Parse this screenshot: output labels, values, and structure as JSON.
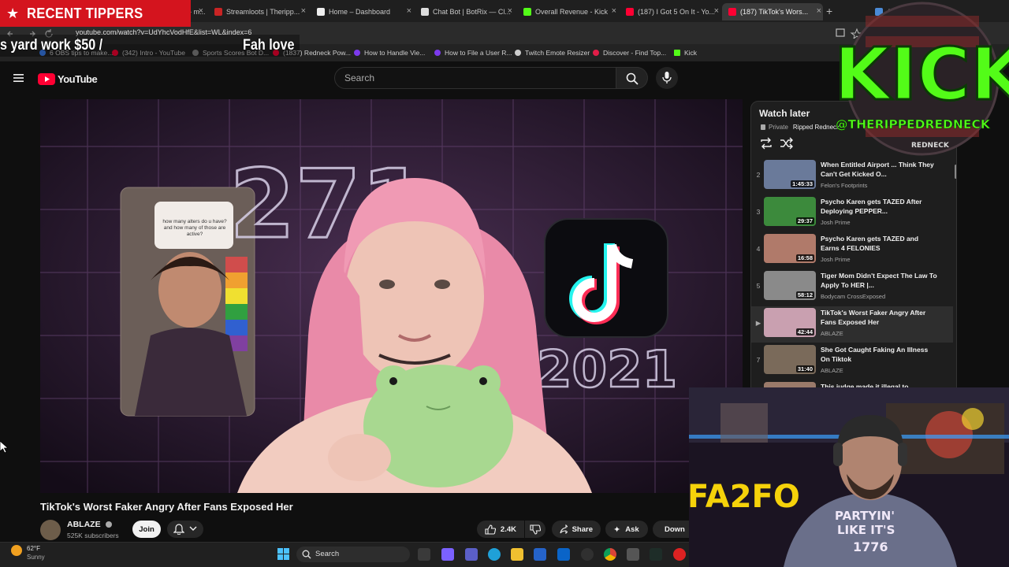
{
  "overlay": {
    "tipper_title": "RECENT TIPPERS",
    "ticker_left": "s yard work $50 /",
    "ticker_right": "Fah love",
    "kick_logo_text": "KICK",
    "kick_handle": "@THERIPPEDREDNECK",
    "kick_logo_sub": "REDNECK",
    "shirt_text_1": "PARTYIN'",
    "shirt_text_2": "LIKE IT'S",
    "shirt_text_3": "1776",
    "webcam_sign": "FA2FO"
  },
  "browser": {
    "tabs": [
      {
        "label": "...eamElements - m...",
        "color": "#4a6fd6",
        "active": false
      },
      {
        "label": "Streamloots | Theripp...",
        "color": "#c92424",
        "active": false
      },
      {
        "label": "Home – Dashboard",
        "color": "#eeeeee",
        "active": false
      },
      {
        "label": "Chat Bot | BotRix — Cl...",
        "color": "#dddddd",
        "active": false
      },
      {
        "label": "Overall Revenue - Kick",
        "color": "#53fc18",
        "active": false
      },
      {
        "label": "(187) I Got 5 On It - Yo...",
        "color": "#ff0033",
        "active": false
      },
      {
        "label": "(187) TikTok's Wors...",
        "color": "#ff0033",
        "active": true
      },
      {
        "label": "Ash...",
        "color": "#4a8ad6",
        "active": false
      }
    ],
    "new_tab": "+",
    "url": "youtube.com/watch?v=UdYhcVodHfE&list=WL&index=6",
    "bookmarks": [
      {
        "label": "6 OBS tips to make...",
        "color": "#3b82f6"
      },
      {
        "label": "(342) Intro - YouTube",
        "color": "#ff0033"
      },
      {
        "label": "Sports Scores Bot D...",
        "color": "#888888"
      },
      {
        "label": "(1837) Redneck Pow...",
        "color": "#ff0033"
      },
      {
        "label": "How to Handle Vie...",
        "color": "#7c3aed"
      },
      {
        "label": "How to File a User R...",
        "color": "#7c3aed"
      },
      {
        "label": "Twitch Emote Resizer",
        "color": "#cccccc"
      },
      {
        "label": "Discover - Find Top...",
        "color": "#e11d48"
      },
      {
        "label": "Kick",
        "color": "#53fc18"
      }
    ]
  },
  "youtube": {
    "logo_text": "YouTube",
    "search_placeholder": "Search",
    "video": {
      "title": "TikTok's Worst Faker Angry After Fans Exposed Her",
      "frame_number": "271",
      "frame_year": "2021",
      "tiktok_caption": "how many alters do u have? and how many of those are active?"
    },
    "channel": {
      "name": "ABLAZE",
      "subscribers": "525K subscribers",
      "join_label": "Join"
    },
    "actions": {
      "like_count": "2.4K",
      "share_label": "Share",
      "ask_label": "Ask",
      "download_label": "Down"
    }
  },
  "playlist": {
    "title": "Watch later",
    "privacy": "Private",
    "owner": "Ripped Redneck",
    "items": [
      {
        "index": "2",
        "title": "When Entitled Airport ... Think They Can't Get Kicked O...",
        "channel": "Felon's Footprints",
        "duration": "1:45:33",
        "thumb": "#6a7a9a",
        "current": false
      },
      {
        "index": "3",
        "title": "Psycho Karen gets TAZED After Deploying PEPPER...",
        "channel": "Josh Prime",
        "duration": "29:37",
        "thumb": "#3c8a3c",
        "current": false
      },
      {
        "index": "4",
        "title": "Psycho Karen gets TAZED and Earns 4 FELONIES",
        "channel": "Josh Prime",
        "duration": "16:58",
        "thumb": "#b07a6a",
        "current": false
      },
      {
        "index": "5",
        "title": "Tiger Mom Didn't Expect The Law To Apply To HER |...",
        "channel": "Bodycam CrossExposed",
        "duration": "58:12",
        "thumb": "#8a8a8a",
        "current": false
      },
      {
        "index": "▶",
        "title": "TikTok's Worst Faker Angry After Fans Exposed Her",
        "channel": "ABLAZE",
        "duration": "42:44",
        "thumb": "#c9a0b0",
        "current": true
      },
      {
        "index": "7",
        "title": "She Got Caught Faking An Illness On Tiktok",
        "channel": "ABLAZE",
        "duration": "31:40",
        "thumb": "#7a6a5a",
        "current": false
      },
      {
        "index": "8",
        "title": "This judge made it illegal to",
        "channel": "",
        "duration": "",
        "thumb": "#9a7a6a",
        "current": false
      }
    ]
  },
  "taskbar": {
    "temperature": "62°F",
    "weather": "Sunny",
    "search_label": "Search"
  }
}
